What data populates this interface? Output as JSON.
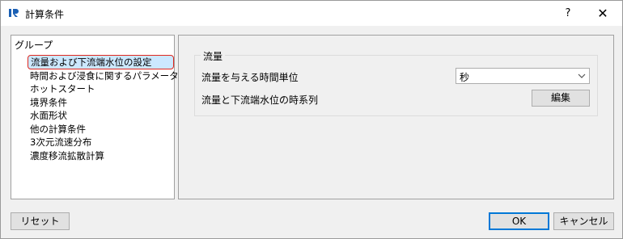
{
  "window": {
    "title": "計算条件",
    "help_label": "?",
    "close_label": "✕",
    "app_icon": "iric-app-icon"
  },
  "groups": {
    "header": "グループ",
    "items": [
      "流量および下流端水位の設定",
      "時間および浸食に関するパラメータ",
      "ホットスタート",
      "境界条件",
      "水面形状",
      "他の計算条件",
      "3次元流速分布",
      "濃度移流拡散計算"
    ],
    "selected_index": 0
  },
  "discharge": {
    "legend": "流量",
    "time_unit_label": "流量を与える時間単位",
    "time_unit_value": "秒",
    "series_label": "流量と下流端水位の時系列",
    "edit_button": "編集"
  },
  "footer": {
    "reset_button": "リセット",
    "ok_button": "OK",
    "cancel_button": "キャンセル"
  },
  "colors": {
    "selection_bg": "#cce8ff",
    "selection_outline": "#e0281e",
    "default_button_border": "#0078d7"
  }
}
